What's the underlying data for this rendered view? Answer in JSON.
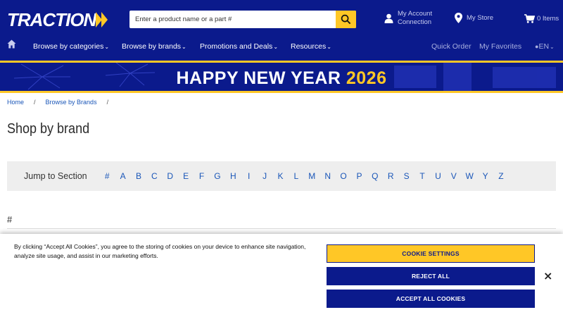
{
  "header": {
    "logo_text": "TRACTION",
    "search_placeholder": "Enter a product name or a part #",
    "account": {
      "line1": "My Account",
      "line2": "Connection"
    },
    "store": "My Store",
    "cart": "0 Items",
    "brand_colors": {
      "navy": "#0b1a8c",
      "yellow": "#ffc726"
    }
  },
  "nav": {
    "home_icon": "home-icon",
    "items": [
      {
        "label": "Browse by categories"
      },
      {
        "label": "Browse by brands"
      },
      {
        "label": "Promotions and Deals"
      },
      {
        "label": "Resources"
      }
    ],
    "quick_order": "Quick Order",
    "favorites": "My Favorites",
    "language": "EN"
  },
  "banner": {
    "title": "HAPPY NEW YEAR",
    "year": "2026"
  },
  "breadcrumb": {
    "home": "Home",
    "current": "Browse by Brands",
    "separator": "/"
  },
  "main": {
    "title": "Shop by brand",
    "jump_label": "Jump to Section",
    "letters": [
      "#",
      "A",
      "B",
      "C",
      "D",
      "E",
      "F",
      "G",
      "H",
      "I",
      "J",
      "K",
      "L",
      "M",
      "N",
      "O",
      "P",
      "Q",
      "R",
      "S",
      "T",
      "U",
      "V",
      "W",
      "Y",
      "Z"
    ],
    "first_section": "#"
  },
  "cookie": {
    "text": "By clicking “Accept All Cookies”, you agree to the storing of cookies on your device to enhance site navigation, analyze site usage, and assist in our marketing efforts.",
    "settings": "COOKIE SETTINGS",
    "reject": "REJECT ALL",
    "accept": "ACCEPT ALL COOKIES",
    "close": "×"
  }
}
